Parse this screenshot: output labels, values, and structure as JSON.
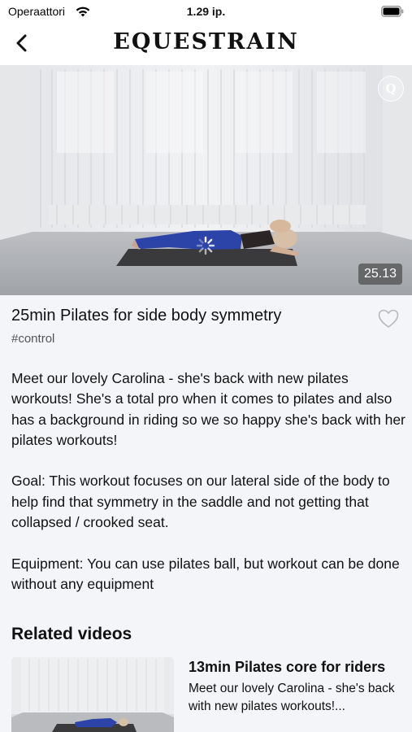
{
  "status_bar": {
    "carrier": "Operaattori",
    "time": "1.29 ip."
  },
  "header": {
    "brand": "EQUESTRAIN",
    "back_icon": "chevron-left-icon"
  },
  "video": {
    "duration": "25.13",
    "badge_icon": "q-logo-icon",
    "loading_icon": "spinner-icon"
  },
  "title": "25min Pilates for side body symmetry",
  "tag": "#control",
  "favorite_icon": "heart-outline-icon",
  "description": {
    "paragraph_1": "Meet our lovely Carolina - she's back with new pilates workouts! She's a total pro when it comes to pilates and also has a background in riding so we so happy she's back with her pilates workouts!",
    "paragraph_2": "Goal: This workout focuses on our lateral side of the body to help find that symmetry in the saddle and not getting that collapsed / crooked seat.",
    "paragraph_3": "Equipment: You can use pilates ball, but workout can be done without any equipment"
  },
  "related": {
    "heading": "Related videos",
    "items": [
      {
        "title": "13min Pilates core for riders",
        "description": "Meet our lovely Carolina - she's back with new pilates workouts!..."
      }
    ]
  },
  "colors": {
    "background": "#f4f5f8",
    "text": "#111111",
    "muted": "#555555",
    "mat": "#3a3a3c",
    "leggings": "#2c44a8"
  }
}
